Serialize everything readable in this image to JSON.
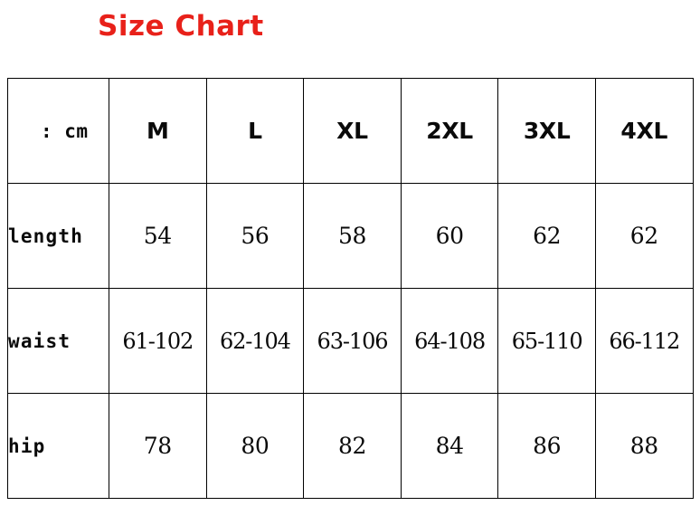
{
  "title": {
    "text": "Size Chart",
    "color": "#e8211a"
  },
  "table": {
    "unit_label": ": cm",
    "row_labels": [
      "length",
      "waist",
      "hip"
    ],
    "sizes": [
      "M",
      "L",
      "XL",
      "2XL",
      "3XL",
      "4XL"
    ],
    "rows": [
      {
        "label": "length",
        "values": [
          "54",
          "56",
          "58",
          "60",
          "62",
          "62"
        ]
      },
      {
        "label": "waist",
        "values": [
          "61-102",
          "62-104",
          "63-106",
          "64-108",
          "65-110",
          "66-112"
        ]
      },
      {
        "label": "hip",
        "values": [
          "78",
          "80",
          "82",
          "84",
          "86",
          "88"
        ]
      }
    ]
  },
  "chart_data": {
    "type": "table",
    "title": "Size Chart",
    "unit": "cm",
    "categories": [
      "M",
      "L",
      "XL",
      "2XL",
      "3XL",
      "4XL"
    ],
    "series": [
      {
        "name": "length",
        "values": [
          "54",
          "56",
          "58",
          "60",
          "62",
          "62"
        ]
      },
      {
        "name": "waist",
        "values": [
          "61-102",
          "62-104",
          "63-106",
          "64-108",
          "65-110",
          "66-112"
        ]
      },
      {
        "name": "hip",
        "values": [
          "78",
          "80",
          "82",
          "84",
          "86",
          "88"
        ]
      }
    ],
    "xlabel": "",
    "ylabel": "",
    "grid": true,
    "legend": "none"
  }
}
